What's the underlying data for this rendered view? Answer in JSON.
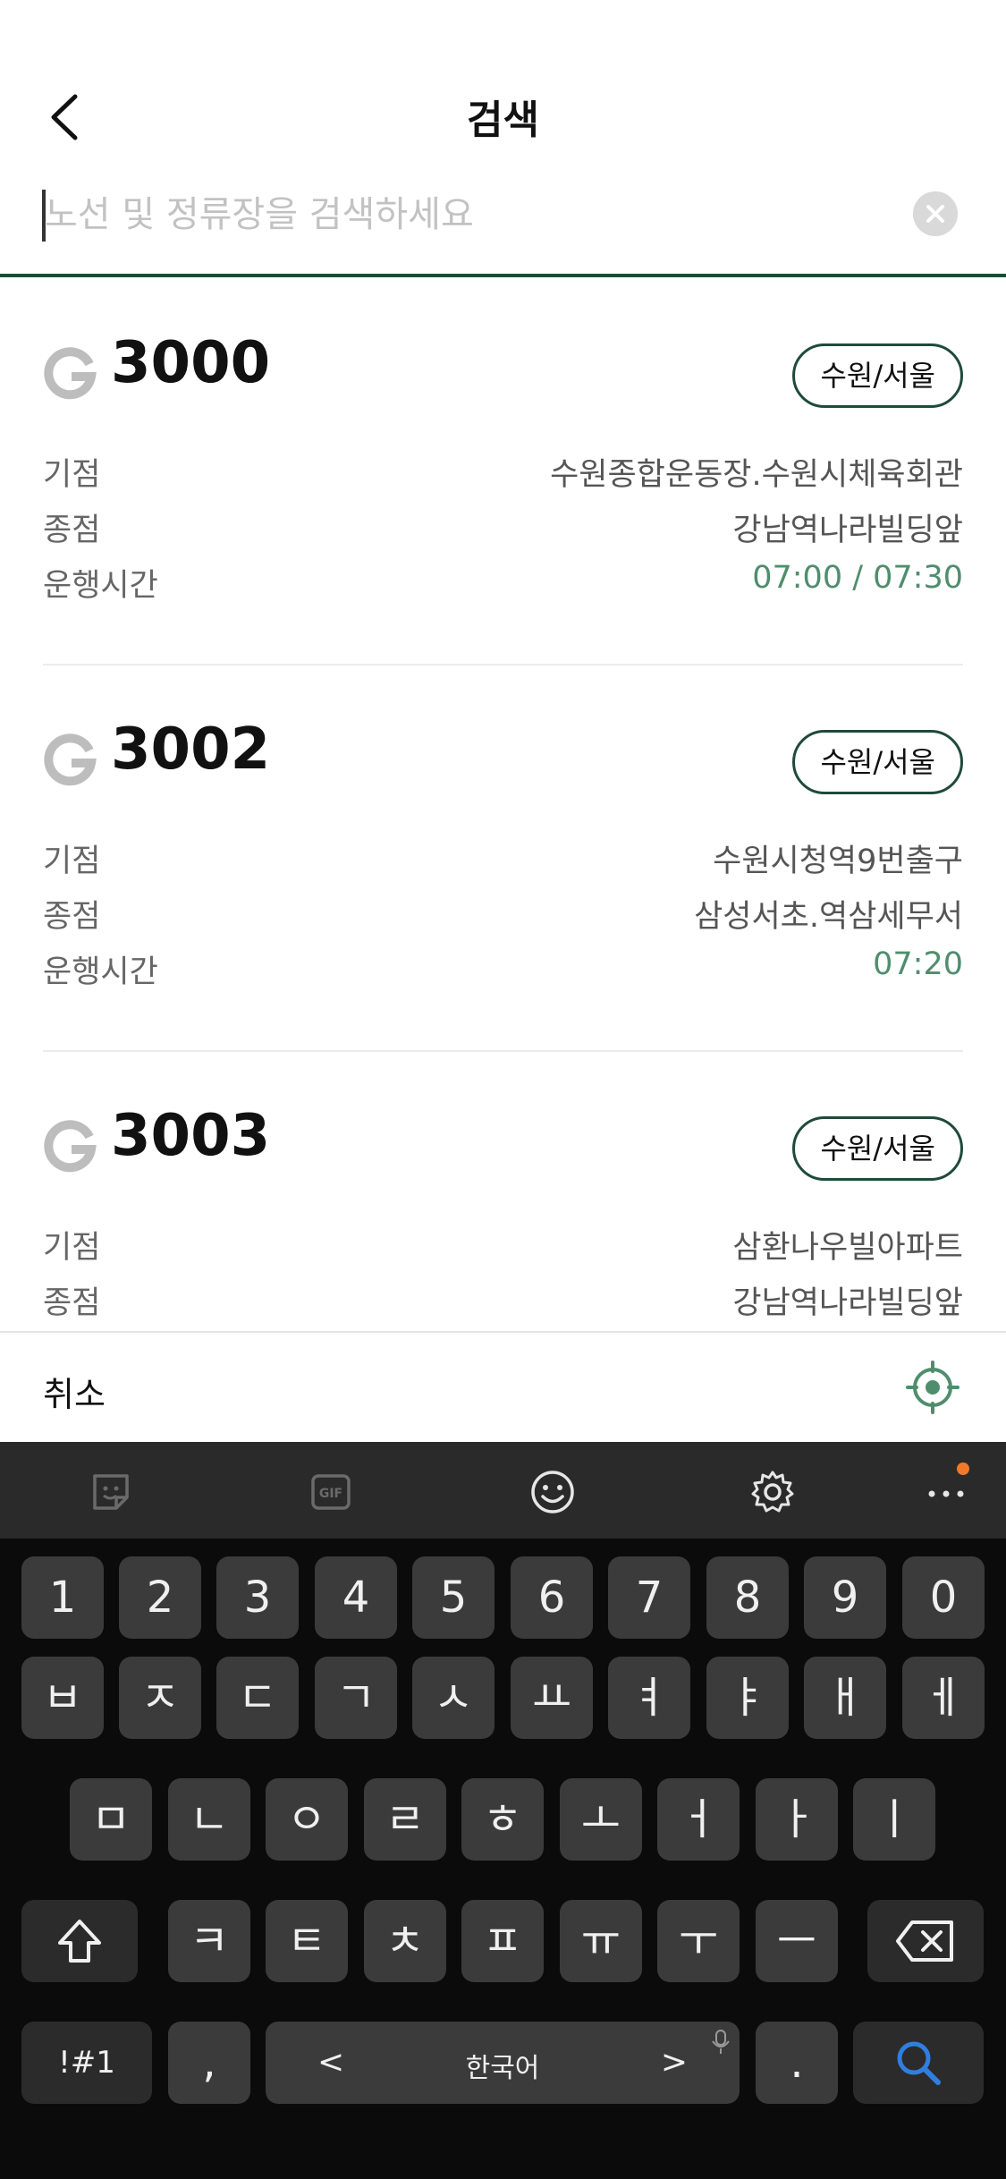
{
  "header": {
    "title": "검색"
  },
  "search": {
    "placeholder": "노선 및 정류장을 검색하세요"
  },
  "routes": [
    {
      "number": "3000",
      "region": "수원/서울",
      "start_label": "기점",
      "start": "수원종합운동장.수원시체육회관",
      "end_label": "종점",
      "end": "강남역나라빌딩앞",
      "hours_label": "운행시간",
      "hours": "07:00 / 07:30"
    },
    {
      "number": "3002",
      "region": "수원/서울",
      "start_label": "기점",
      "start": "수원시청역9번출구",
      "end_label": "종점",
      "end": "삼성서초.역삼세무서",
      "hours_label": "운행시간",
      "hours": "07:20"
    },
    {
      "number": "3003",
      "region": "수원/서울",
      "start_label": "기점",
      "start": "삼환나우빌아파트",
      "end_label": "종점",
      "end": "강남역나라빌딩앞"
    }
  ],
  "bottom": {
    "cancel_label": "취소",
    "location_icon": "target-icon"
  },
  "keyboard": {
    "toolbar_icons": [
      "sticker-icon",
      "gif-icon",
      "emoji-icon",
      "settings-icon",
      "more-icon"
    ],
    "row_numbers": [
      "1",
      "2",
      "3",
      "4",
      "5",
      "6",
      "7",
      "8",
      "9",
      "0"
    ],
    "row1": [
      "ㅂ",
      "ㅈ",
      "ㄷ",
      "ㄱ",
      "ㅅ",
      "ㅛ",
      "ㅕ",
      "ㅑ",
      "ㅐ",
      "ㅔ"
    ],
    "row2": [
      "ㅁ",
      "ㄴ",
      "ㅇ",
      "ㄹ",
      "ㅎ",
      "ㅗ",
      "ㅓ",
      "ㅏ",
      "ㅣ"
    ],
    "row3": [
      "ㅋ",
      "ㅌ",
      "ㅊ",
      "ㅍ",
      "ㅠ",
      "ㅜ",
      "ㅡ"
    ],
    "symbols_label": "!#1",
    "comma": ",",
    "space_label": "한국어",
    "space_left": "<",
    "space_right": ">",
    "period": ".",
    "accent_color": "#2f7fe0",
    "notification_dot_color": "#f07a2a"
  },
  "colors": {
    "brand_green": "#1f4a3a",
    "time_green": "#4f8e6d"
  }
}
